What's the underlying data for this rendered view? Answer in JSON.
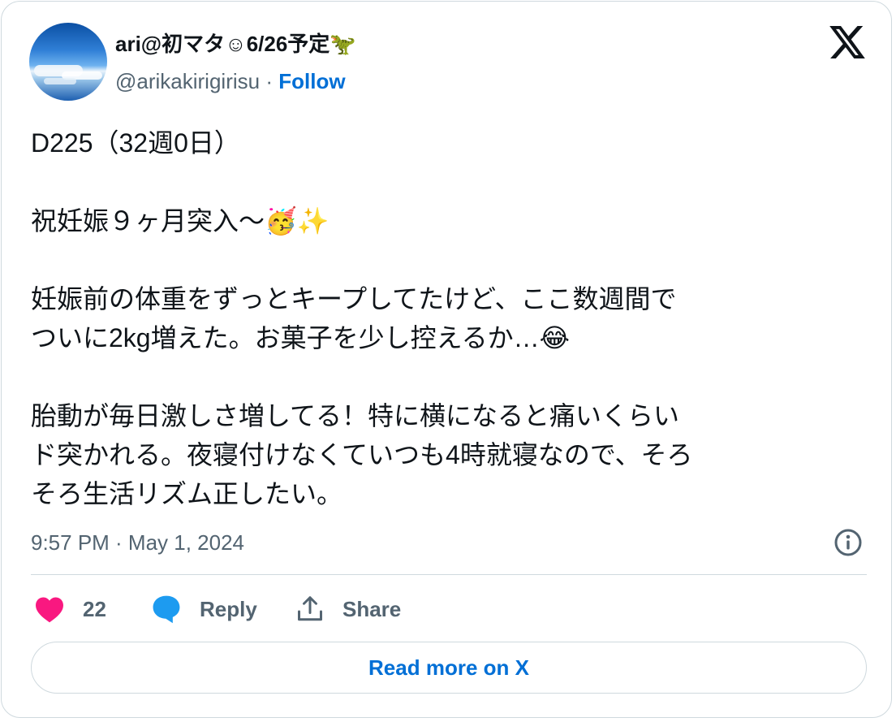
{
  "author": {
    "display_name": "ari@初マタ☺6/26予定",
    "display_name_emoji": "🦖",
    "handle": "@arikakirigirisu",
    "separator": "·",
    "follow_label": "Follow",
    "avatar_icon": "avatar-sky-clouds"
  },
  "tweet": {
    "text": "D225（32週0日）\n\n祝妊娠９ヶ月突入〜🥳✨\n\n妊娠前の体重をずっとキープしてたけど、ここ数週間で\nついに2kg増えた。お菓子を少し控えるか…😂\n\n胎動が毎日激しさ増してる！特に横になると痛いくらい\nド突かれる。夜寝付けなくていつも4時就寝なので、そろ\nそろ生活リズム正したい。",
    "timestamp": "9:57 PM · May 1, 2024"
  },
  "actions": {
    "like_count": "22",
    "reply_label": "Reply",
    "share_label": "Share"
  },
  "read_more_label": "Read more on X",
  "icons": {
    "platform": "x-logo-icon",
    "info": "info-icon",
    "like": "heart-icon",
    "reply": "speech-bubble-icon",
    "share": "share-arrow-icon"
  },
  "colors": {
    "link": "#006fd6",
    "muted": "#536471",
    "like": "#f91880",
    "reply": "#1d9bf0",
    "border": "#cfd9de"
  }
}
